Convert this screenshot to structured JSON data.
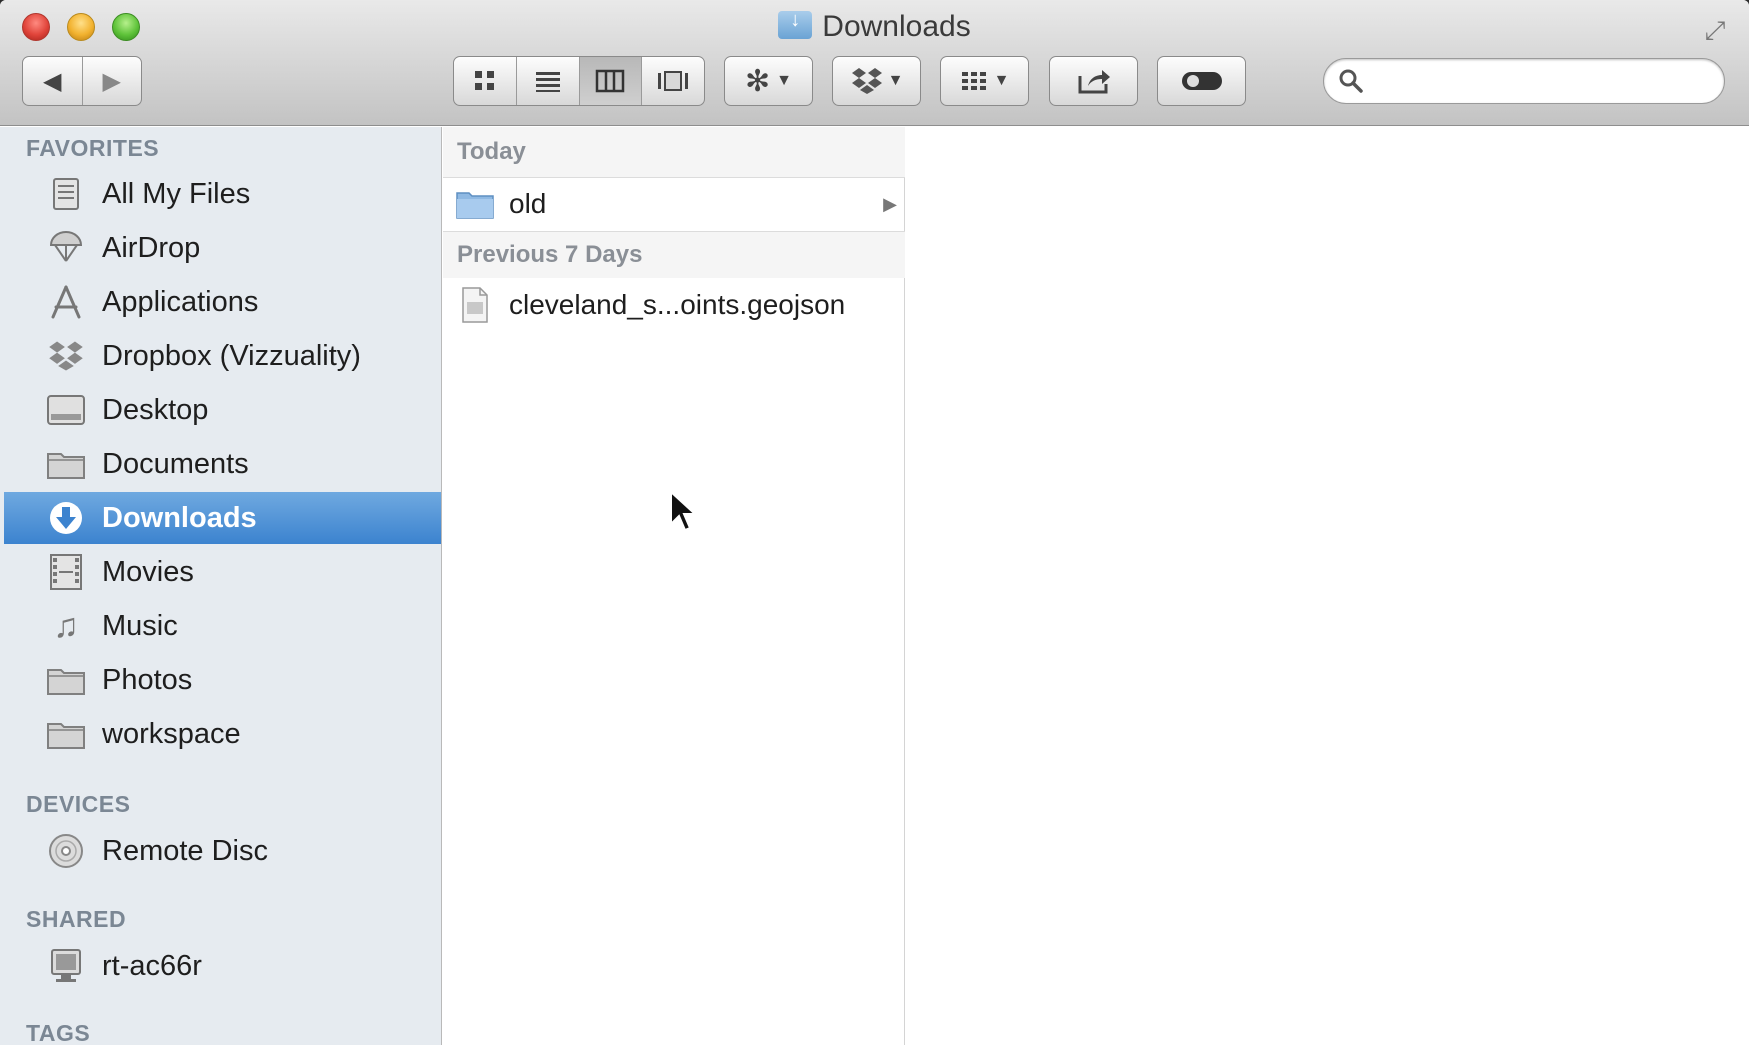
{
  "window": {
    "title": "Downloads"
  },
  "toolbar": {
    "back_icon": "back-arrow-icon",
    "forward_icon": "forward-arrow-icon",
    "view_modes": [
      "icon-view-icon",
      "list-view-icon",
      "column-view-icon",
      "cover-flow-icon"
    ],
    "active_view": "column-view",
    "search_placeholder": ""
  },
  "sidebar": {
    "favorites_header": "FAVORITES",
    "favorites": [
      {
        "label": "All My Files",
        "icon": "all-my-files-icon"
      },
      {
        "label": "AirDrop",
        "icon": "airdrop-icon"
      },
      {
        "label": "Applications",
        "icon": "applications-icon"
      },
      {
        "label": "Dropbox (Vizzuality)",
        "icon": "dropbox-icon"
      },
      {
        "label": "Desktop",
        "icon": "desktop-icon"
      },
      {
        "label": "Documents",
        "icon": "folder-icon"
      },
      {
        "label": "Downloads",
        "icon": "downloads-icon",
        "selected": true
      },
      {
        "label": "Movies",
        "icon": "movies-icon"
      },
      {
        "label": "Music",
        "icon": "music-icon"
      },
      {
        "label": "Photos",
        "icon": "folder-icon"
      },
      {
        "label": "workspace",
        "icon": "folder-icon"
      }
    ],
    "devices_header": "DEVICES",
    "devices": [
      {
        "label": "Remote Disc",
        "icon": "remote-disc-icon"
      }
    ],
    "shared_header": "SHARED",
    "shared": [
      {
        "label": "rt-ac66r",
        "icon": "network-computer-icon"
      }
    ],
    "tags_header": "TAGS"
  },
  "column1": {
    "groups": [
      {
        "header": "Today",
        "items": [
          {
            "name": "old",
            "type": "folder"
          }
        ]
      },
      {
        "header": "Previous 7 Days",
        "items": [
          {
            "name": "cleveland_s...oints.geojson",
            "type": "file"
          }
        ]
      }
    ]
  },
  "colors": {
    "selection": "#3c83cf",
    "sidebar_bg": "#e6ebf0",
    "section_header": "#7b8794"
  }
}
